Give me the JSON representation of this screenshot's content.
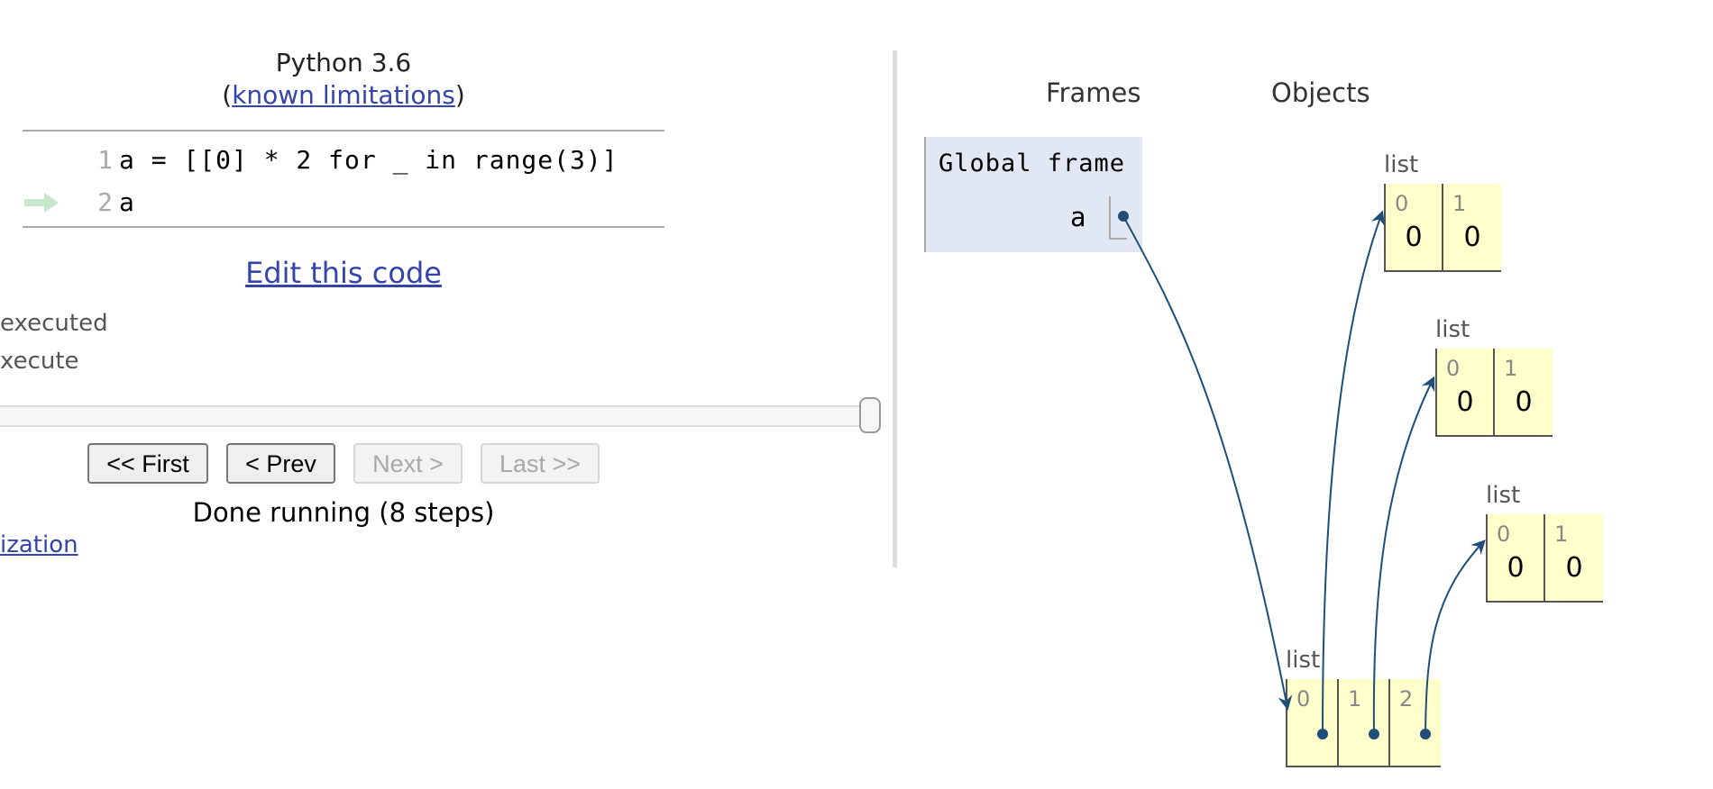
{
  "editor": {
    "language": "Python 3.6",
    "limitations_open": "(",
    "limitations_link": "known limitations",
    "limitations_close": ")",
    "lines": [
      {
        "number": "1",
        "code": "a = [[0] * 2 for _ in range(3)]",
        "current": false
      },
      {
        "number": "2",
        "code": "a",
        "current": true
      }
    ],
    "edit_link": "Edit this code"
  },
  "legend": {
    "executed": "executed",
    "execute": "xecute"
  },
  "navigation": {
    "slider_progress": 1.0,
    "first_label": "<< First",
    "prev_label": "< Prev",
    "next_label": "Next >",
    "last_label": "Last >>",
    "next_disabled": true,
    "last_disabled": true,
    "status": "Done running (8 steps)",
    "viz_link": "ization"
  },
  "visualization": {
    "frames_header": "Frames",
    "objects_header": "Objects",
    "global_frame": {
      "title": "Global frame",
      "variables": [
        {
          "name": "a",
          "type": "pointer",
          "target": "outer_list"
        }
      ]
    },
    "objects": {
      "inner_list_0": {
        "type_label": "list",
        "items": [
          {
            "index": "0",
            "value": "0"
          },
          {
            "index": "1",
            "value": "0"
          }
        ]
      },
      "inner_list_1": {
        "type_label": "list",
        "items": [
          {
            "index": "0",
            "value": "0"
          },
          {
            "index": "1",
            "value": "0"
          }
        ]
      },
      "inner_list_2": {
        "type_label": "list",
        "items": [
          {
            "index": "0",
            "value": "0"
          },
          {
            "index": "1",
            "value": "0"
          }
        ]
      },
      "outer_list": {
        "type_label": "list",
        "items": [
          {
            "index": "0",
            "pointer": "inner_list_0"
          },
          {
            "index": "1",
            "pointer": "inner_list_1"
          },
          {
            "index": "2",
            "pointer": "inner_list_2"
          }
        ]
      }
    },
    "colors": {
      "pointer": "#1f4e79",
      "frame_bg": "#e2e8f3",
      "heap_bg": "#ffffcc",
      "link": "#3344aa",
      "current_line_arrow": "#c8e6c9"
    }
  }
}
